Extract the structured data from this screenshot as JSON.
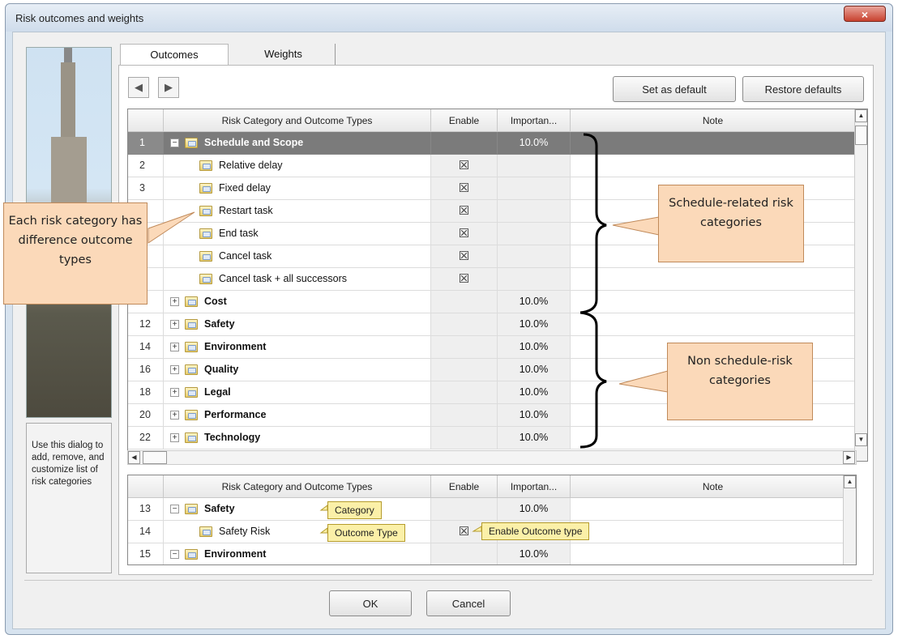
{
  "window": {
    "title": "Risk outcomes and weights",
    "close_label": "×"
  },
  "sidebar": {
    "info_text": "Use this dialog to add, remove, and customize list of risk categories"
  },
  "tabs": [
    {
      "label": "Outcomes",
      "active": true
    },
    {
      "label": "Weights",
      "active": false
    }
  ],
  "toolbar": {
    "back_glyph": "◀",
    "forward_glyph": "▶",
    "set_default_label": "Set as default",
    "restore_defaults_label": "Restore defaults"
  },
  "grid": {
    "columns": [
      "Risk Category and Outcome Types",
      "Enable",
      "Importan...",
      "Note"
    ],
    "rows": [
      {
        "num": "1",
        "name": "Schedule and Scope",
        "level": 0,
        "expander": "−",
        "enable": "",
        "importance": "10.0%",
        "selected": true
      },
      {
        "num": "2",
        "name": "Relative delay",
        "level": 1,
        "expander": "",
        "enable": "☒",
        "importance": "",
        "selected": false
      },
      {
        "num": "3",
        "name": "Fixed delay",
        "level": 1,
        "expander": "",
        "enable": "☒",
        "importance": "",
        "selected": false
      },
      {
        "num": "",
        "name": "Restart task",
        "level": 1,
        "expander": "",
        "enable": "☒",
        "importance": "",
        "selected": false
      },
      {
        "num": "",
        "name": "End task",
        "level": 1,
        "expander": "",
        "enable": "☒",
        "importance": "",
        "selected": false
      },
      {
        "num": "",
        "name": "Cancel task",
        "level": 1,
        "expander": "",
        "enable": "☒",
        "importance": "",
        "selected": false
      },
      {
        "num": "",
        "name": "Cancel task + all successors",
        "level": 1,
        "expander": "",
        "enable": "☒",
        "importance": "",
        "selected": false
      },
      {
        "num": "",
        "name": "Cost",
        "level": 0,
        "expander": "+",
        "enable": "",
        "importance": "10.0%",
        "selected": false
      },
      {
        "num": "12",
        "name": "Safety",
        "level": 0,
        "expander": "+",
        "enable": "",
        "importance": "10.0%",
        "selected": false
      },
      {
        "num": "14",
        "name": "Environment",
        "level": 0,
        "expander": "+",
        "enable": "",
        "importance": "10.0%",
        "selected": false
      },
      {
        "num": "16",
        "name": "Quality",
        "level": 0,
        "expander": "+",
        "enable": "",
        "importance": "10.0%",
        "selected": false
      },
      {
        "num": "18",
        "name": "Legal",
        "level": 0,
        "expander": "+",
        "enable": "",
        "importance": "10.0%",
        "selected": false
      },
      {
        "num": "20",
        "name": "Performance",
        "level": 0,
        "expander": "+",
        "enable": "",
        "importance": "10.0%",
        "selected": false
      },
      {
        "num": "22",
        "name": "Technology",
        "level": 0,
        "expander": "+",
        "enable": "",
        "importance": "10.0%",
        "selected": false
      }
    ]
  },
  "grid2": {
    "columns": [
      "Risk Category and Outcome Types",
      "Enable",
      "Importan...",
      "Note"
    ],
    "rows": [
      {
        "num": "13",
        "name": "Safety",
        "level": 0,
        "expander": "−",
        "enable": "",
        "importance": "10.0%"
      },
      {
        "num": "14",
        "name": "Safety Risk",
        "level": 1,
        "expander": "",
        "enable": "☒",
        "importance": ""
      },
      {
        "num": "15",
        "name": "Environment",
        "level": 0,
        "expander": "−",
        "enable": "",
        "importance": "10.0%"
      }
    ]
  },
  "annotations": {
    "each_risk": "Each risk category has difference outcome types",
    "schedule_related": "Schedule-related risk categories",
    "non_schedule": "Non schedule-risk categories",
    "category_tag": "Category",
    "outcome_type_tag": "Outcome Type",
    "enable_outcome_tag": "Enable Outcome type"
  },
  "footer": {
    "ok_label": "OK",
    "cancel_label": "Cancel"
  },
  "scroll": {
    "up": "▲",
    "down": "▼",
    "left": "◀",
    "right": "▶"
  }
}
